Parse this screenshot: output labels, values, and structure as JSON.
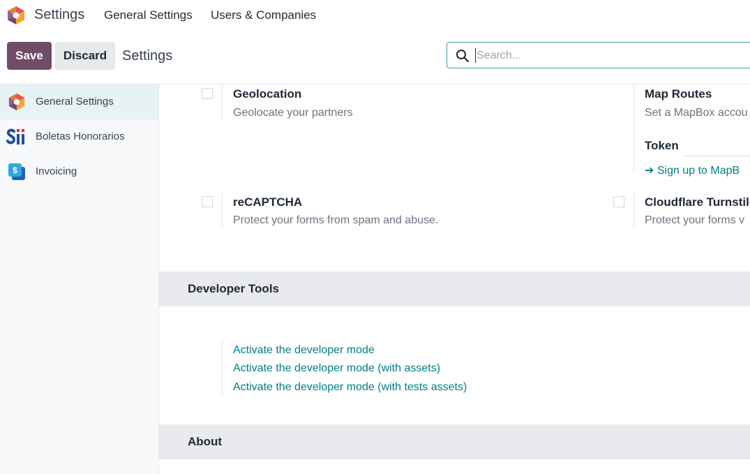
{
  "app": {
    "name": "Settings"
  },
  "topmenu": {
    "general_settings": "General Settings",
    "users_companies": "Users & Companies"
  },
  "toolbar": {
    "save_label": "Save",
    "discard_label": "Discard",
    "breadcrumb": "Settings"
  },
  "search": {
    "placeholder": "Search..."
  },
  "sidebar": {
    "items": [
      {
        "label": "General Settings",
        "icon": "settings-app-icon",
        "active": true
      },
      {
        "label": "Boletas Honorarios",
        "icon": "sii-logo-icon",
        "active": false
      },
      {
        "label": "Invoicing",
        "icon": "invoicing-app-icon",
        "active": false
      }
    ]
  },
  "settings": {
    "geolocation": {
      "title": "Geolocation",
      "desc": "Geolocate your partners"
    },
    "map_routes": {
      "title": "Map Routes",
      "desc": "Set a MapBox accou",
      "token_label": "Token",
      "signup_link": "➔ Sign up to MapB"
    },
    "recaptcha": {
      "title": "reCAPTCHA",
      "desc": "Protect your forms from spam and abuse."
    },
    "turnstile": {
      "title": "Cloudflare Turnstile",
      "desc": "Protect your forms v"
    }
  },
  "developer_tools": {
    "title": "Developer Tools",
    "links": [
      "Activate the developer mode",
      "Activate the developer mode (with assets)",
      "Activate the developer mode (with tests assets)"
    ]
  },
  "about": {
    "title": "About"
  },
  "colors": {
    "accent": "#714b67",
    "link": "#017e84",
    "search_border": "#3b9ca0"
  }
}
